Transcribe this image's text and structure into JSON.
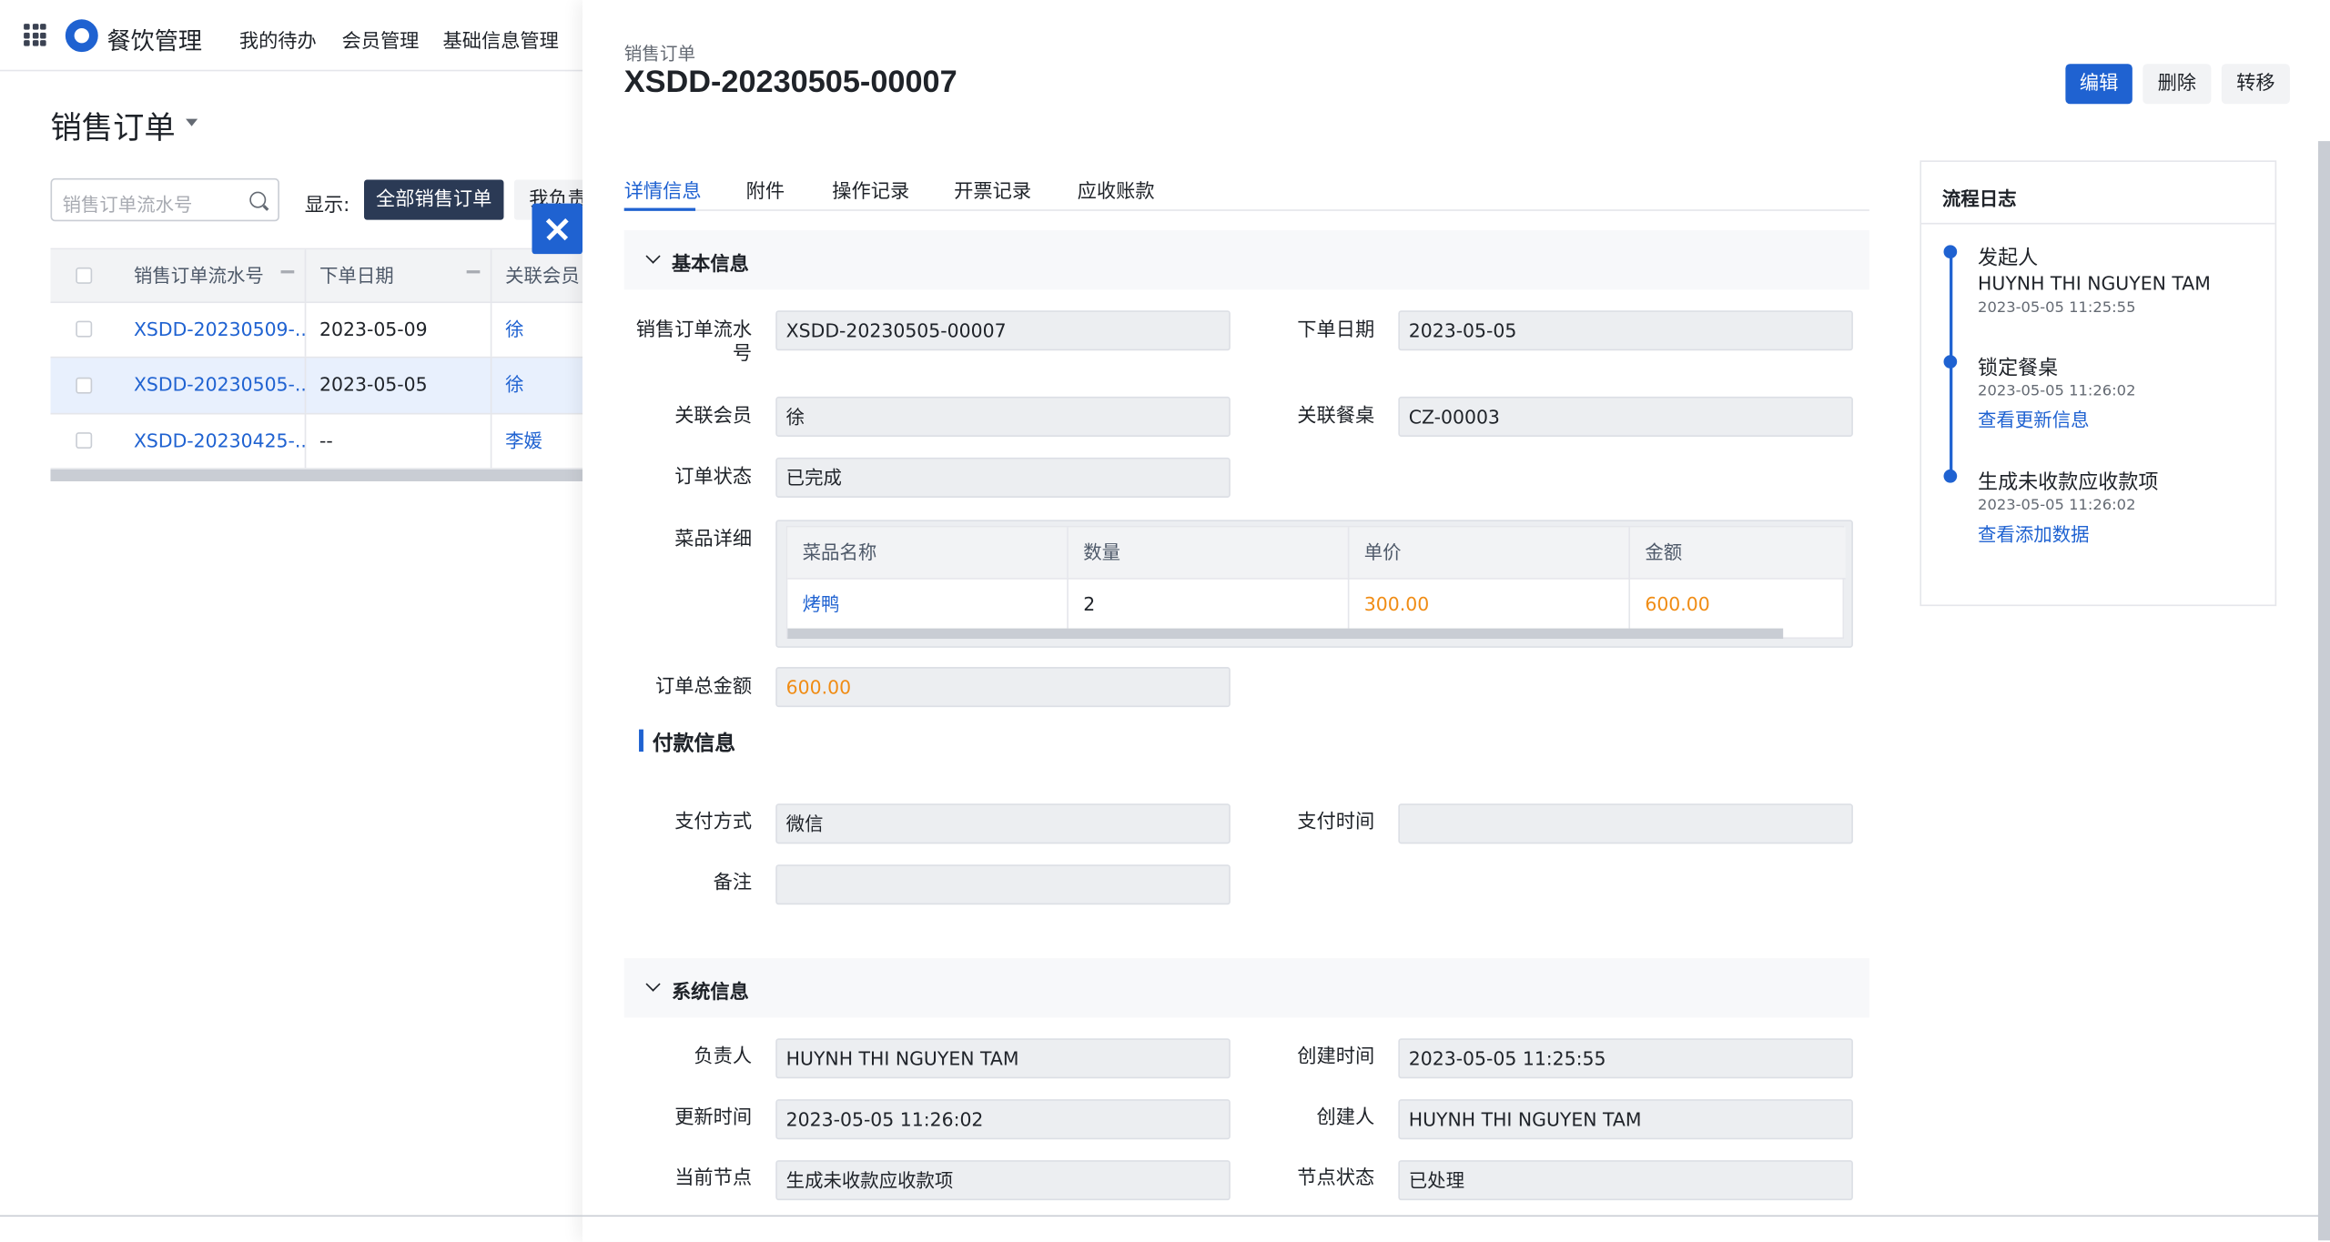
{
  "nav": {
    "app_title": "餐饮管理",
    "items": [
      "我的待办",
      "会员管理",
      "基础信息管理"
    ]
  },
  "list": {
    "page_title": "销售订单",
    "search_placeholder": "销售订单流水号",
    "show_label": "显示:",
    "filter_active": "全部销售订单",
    "filter_other": "我负责",
    "columns": [
      "销售订单流水号",
      "下单日期",
      "关联会员"
    ],
    "rows": [
      {
        "no": "XSDD-20230509-...",
        "date": "2023-05-09",
        "member": "徐"
      },
      {
        "no": "XSDD-20230505-...",
        "date": "2023-05-05",
        "member": "徐"
      },
      {
        "no": "XSDD-20230425-...",
        "date": "--",
        "member": "李媛"
      }
    ]
  },
  "drawer": {
    "subtitle": "销售订单",
    "title": "XSDD-20230505-00007",
    "actions": {
      "edit": "编辑",
      "delete": "删除",
      "transfer": "转移"
    },
    "tabs": [
      "详情信息",
      "附件",
      "操作记录",
      "开票记录",
      "应收账款"
    ],
    "basic": {
      "section_title": "基本信息",
      "order_no_label": "销售订单流水号",
      "order_no": "XSDD-20230505-00007",
      "order_date_label": "下单日期",
      "order_date": "2023-05-05",
      "member_label": "关联会员",
      "member": "徐",
      "table_label": "关联餐桌",
      "table": "CZ-00003",
      "status_label": "订单状态",
      "status": "已完成",
      "dishes_label": "菜品详细",
      "dish_columns": [
        "菜品名称",
        "数量",
        "单价",
        "金额"
      ],
      "dish_rows": [
        {
          "name": "烤鸭",
          "qty": "2",
          "price": "300.00",
          "amount": "600.00"
        }
      ],
      "total_label": "订单总金额",
      "total": "600.00"
    },
    "payment": {
      "section_title": "付款信息",
      "method_label": "支付方式",
      "method": "微信",
      "time_label": "支付时间",
      "time": "",
      "remark_label": "备注",
      "remark": ""
    },
    "system": {
      "section_title": "系统信息",
      "owner_label": "负责人",
      "owner": "HUYNH THI NGUYEN TAM",
      "created_label": "创建时间",
      "created": "2023-05-05 11:25:55",
      "updated_label": "更新时间",
      "updated": "2023-05-05 11:26:02",
      "creator_label": "创建人",
      "creator": "HUYNH THI NGUYEN TAM",
      "node_label": "当前节点",
      "node": "生成未收款应收款项",
      "node_status_label": "节点状态",
      "node_status": "已处理"
    },
    "flow": {
      "title": "流程日志",
      "entries": [
        {
          "title": "发起人",
          "name": "HUYNH THI NGUYEN TAM",
          "time": "2023-05-05 11:25:55"
        },
        {
          "title": "锁定餐桌",
          "time": "2023-05-05 11:26:02",
          "link": "查看更新信息"
        },
        {
          "title": "生成未收款应收款项",
          "time": "2023-05-05 11:26:02",
          "link": "查看添加数据"
        }
      ]
    }
  },
  "colors": {
    "primary": "#1f62d1",
    "dark_button": "#2b3a55",
    "amount": "#f08c14"
  }
}
